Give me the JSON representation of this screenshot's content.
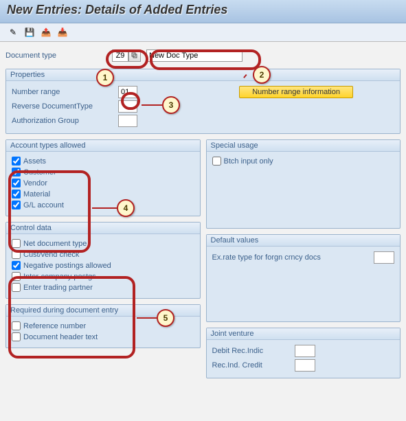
{
  "header": {
    "title": "New Entries: Details of Added Entries"
  },
  "toolbar": {
    "change_icon": "✎",
    "save_icon": "💾",
    "back_icon": "📤",
    "next_icon": "📥"
  },
  "doc_type": {
    "label": "Document type",
    "code": "Z9",
    "name": "New Doc Type"
  },
  "properties": {
    "title": "Properties",
    "number_range_label": "Number range",
    "number_range_value": "01",
    "reverse_label": "Reverse DocumentType",
    "reverse_value": "",
    "auth_label": "Authorization Group",
    "auth_value": "",
    "btn_label": "Number range information"
  },
  "account_types": {
    "title": "Account types allowed",
    "items": [
      {
        "label": "Assets",
        "checked": true
      },
      {
        "label": "Customer",
        "checked": true
      },
      {
        "label": "Vendor",
        "checked": true
      },
      {
        "label": "Material",
        "checked": true
      },
      {
        "label": "G/L account",
        "checked": true
      }
    ]
  },
  "special_usage": {
    "title": "Special usage",
    "items": [
      {
        "label": "Btch input only",
        "checked": false
      }
    ]
  },
  "control_data": {
    "title": "Control data",
    "items": [
      {
        "label": "Net document type",
        "checked": false
      },
      {
        "label": "Cust/vend check",
        "checked": false
      },
      {
        "label": "Negative postings allowed",
        "checked": true
      },
      {
        "label": "Inter-company postgs",
        "checked": false
      },
      {
        "label": "Enter trading partner",
        "checked": false
      }
    ]
  },
  "default_values": {
    "title": "Default values",
    "exrate_label": "Ex.rate type for forgn crncy docs",
    "exrate_value": ""
  },
  "required_entry": {
    "title": "Required during document entry",
    "items": [
      {
        "label": "Reference number",
        "checked": false
      },
      {
        "label": "Document header text",
        "checked": false
      }
    ]
  },
  "joint_venture": {
    "title": "Joint venture",
    "debit_label": "Debit Rec.Indic",
    "debit_value": "",
    "credit_label": "Rec.Ind. Credit",
    "credit_value": ""
  },
  "callouts": {
    "c1": "1",
    "c2": "2",
    "c3": "3",
    "c4": "4",
    "c5": "5"
  }
}
